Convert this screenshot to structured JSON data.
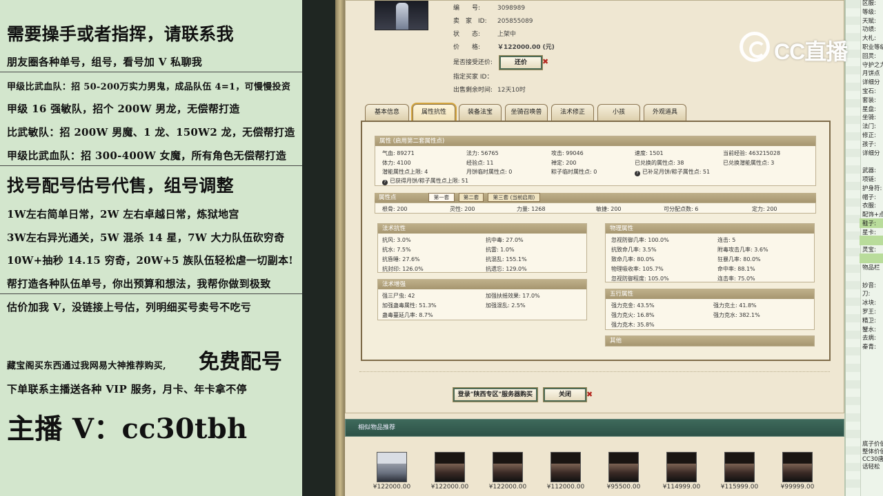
{
  "overlay": {
    "line1": "需要操手或者指挥，请联系我",
    "line2": "朋友圈各种单号，组号，看号加 V 私聊我",
    "line3": "甲级比武血队：招 50-200万实力男鬼，成品队伍 4=1，可慢慢投资",
    "line4": "甲级 16 强敏队，招个 200W 男龙，无偿帮打造",
    "line5": "比武敏队：招 200W 男魔、1 龙、150W2 龙，无偿帮打造",
    "line6": "甲级比武血队：招 300-400W 女魔，所有角色无偿帮打造",
    "line7": "找号配号估号代售，组号调整",
    "line8": "1W左右简单日常，2W 左右卓越日常，炼狱地宫",
    "line9": "3W左右异光通关，5W 混杀 14 星，7W 大力队伍砍穷奇",
    "line10": "10W+抽秒 14.15 穷奇，20W+5 族队伍轻松虐一切副本!",
    "line11": "帮打造各种队伍单号，你出预算和想法，我帮你做到极致",
    "line12": "估价加我 V，没链接上号估，列明细买号卖号不吃亏",
    "line13a": "藏宝阁买东西通过我网易大神推荐购买,",
    "line13b": "免费配号",
    "line14": "下单联系主播送各种 VIP 服务，月卡、年卡拿不停",
    "line15": "主播 V：cc30tbh"
  },
  "item": {
    "num_label": "编　　号:",
    "num_value": "3098989",
    "seller_label": "卖　家　ID:",
    "seller_value": "205855089",
    "status_label": "状　　态:",
    "status_value": "上架中",
    "price_label": "价　　格:",
    "price_value": "￥122000.00 (元)",
    "bargain_label": "是否接受还价:",
    "bargain_button": "还价",
    "buyer_label": "指定买家 ID：",
    "remain_label": "出售剩余时间:",
    "remain_value": "12天10时"
  },
  "tabs": [
    "基本信息",
    "属性抗性",
    "装备法宝",
    "坐骑召唤兽",
    "法术修正",
    "小孩",
    "外观道具"
  ],
  "attr": {
    "header": "属性 (启用第二套属性点)",
    "r1": [
      "气血: 89271",
      "法力: 56765",
      "攻击: 99046",
      "速度: 1501",
      "当前经验: 463215028"
    ],
    "r2": [
      "体力: 4100",
      "经验点: 11",
      "禅定: 200",
      "已兑换的属性点: 38",
      "已兑换潜能属性点: 3"
    ],
    "r3": [
      "潜能属性点上限: 4",
      "月饼临时属性点: 0",
      "粽子临时属性点: 0",
      "已补足月饼/粽子属性点: 51"
    ],
    "r4": "已获得月饼/粽子属性点上限: 51"
  },
  "points": {
    "header": "属性点",
    "subtabs": [
      "第一套",
      "第二套",
      "第三套 (当前启用)"
    ],
    "row": [
      "根骨: 200",
      "灵性: 200",
      "力量: 1268",
      "敏捷: 200",
      "可分配点数: 6",
      "定力: 200"
    ]
  },
  "spell_res": {
    "header": "法术抗性",
    "rows": [
      [
        "抗风: 3.0%",
        "抗中毒: 27.0%"
      ],
      [
        "抗水: 7.5%",
        "抗雷: 1.0%"
      ],
      [
        "抗昏睡: 27.6%",
        "抗混乱: 155.1%"
      ],
      [
        "抗封印: 126.0%",
        "抗遗忘: 129.0%"
      ]
    ]
  },
  "spell_boost": {
    "header": "法术增强",
    "rows": [
      [
        "强三尸虫: 42",
        "加强扶摇效果: 17.0%"
      ],
      [
        "加强蛊毒属性: 51.3%",
        "加强混乱: 2.5%"
      ],
      [
        "蛊毒蔓延几率: 8.7%",
        ""
      ]
    ]
  },
  "phys": {
    "header": "物理属性",
    "rows": [
      [
        "忽视防御几率: 100.0%",
        "连击: 5"
      ],
      [
        "抗致命几率: 3.5%",
        "附毒攻击几率: 3.6%"
      ],
      [
        "致命几率: 80.0%",
        "狂暴几率: 80.0%"
      ],
      [
        "物理吸收率: 105.7%",
        "命中率: 88.1%"
      ],
      [
        "忽视防御程度: 105.0%",
        "连击率: 75.0%"
      ]
    ]
  },
  "five": {
    "header": "五行属性",
    "rows": [
      [
        "强力克金: 43.5%",
        "强力克土: 41.8%"
      ],
      [
        "强力克火: 16.8%",
        "强力克水: 382.1%"
      ],
      [
        "强力克木: 35.8%",
        ""
      ]
    ]
  },
  "other": {
    "header": "其他"
  },
  "actions": {
    "login": "登录\"陕西专区\"服务器购买",
    "close": "关闭"
  },
  "recommend": {
    "title": "相似物品推荐",
    "prices": [
      "¥122000.00",
      "¥122000.00",
      "¥122000.00",
      "¥112000.00",
      "¥95500.00",
      "¥114999.00",
      "¥115999.00",
      "¥99999.00"
    ]
  },
  "right_panel": {
    "items": [
      "区服:",
      "等级:",
      "天赋:",
      "功绩:",
      "大札:",
      "职业等级",
      "回灵:",
      "守护之力",
      "月饼点",
      "详细分",
      "宝石:",
      "套装:",
      "星盘:",
      "坐骑:",
      "法门:",
      "修正:",
      "孩子:",
      "详细分",
      "",
      "武器:",
      "项链:",
      "护身符:",
      "帽子:",
      "衣服:",
      "配饰+点",
      "鞋子:",
      "星卡:",
      "",
      "灵宝:",
      "",
      "物品栏",
      "",
      "妙音:",
      "刀:",
      "冰块:",
      "罗王:",
      "精卫:",
      "蟹水:",
      "去病:",
      "秦青:"
    ],
    "bottom": [
      "底子价值",
      "整体价值",
      "CC30唐",
      "话轻松"
    ]
  },
  "logo": {
    "text": "CC直播"
  },
  "colors": {
    "price": "#c81a12",
    "rec_bar": "#2d5247",
    "overlay_bg": "#d3e6cd"
  }
}
